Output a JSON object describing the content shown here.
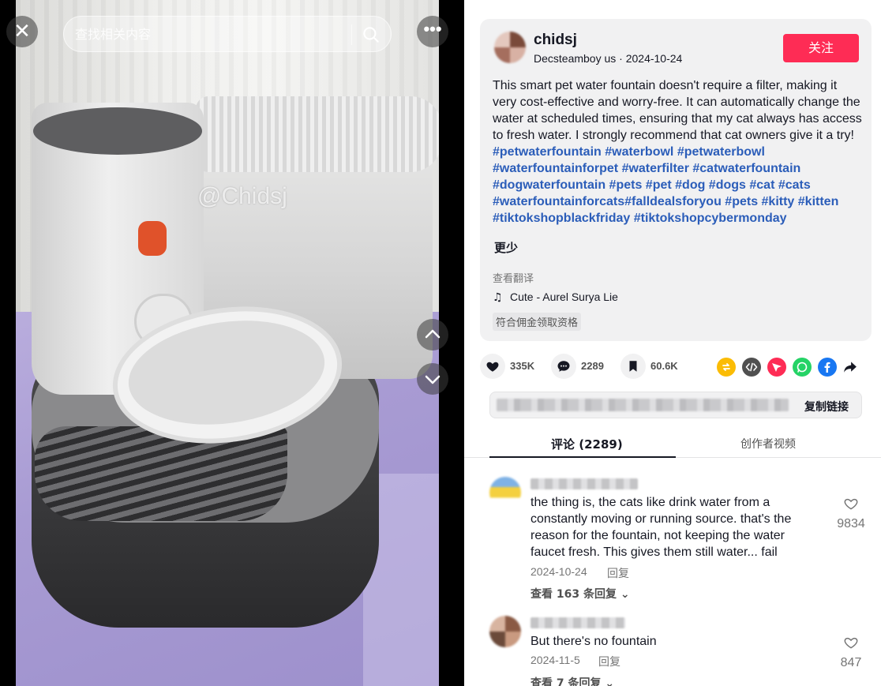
{
  "video": {
    "watermark": "@Chidsj",
    "search_placeholder": "查找相关内容"
  },
  "post": {
    "author": "chidsj",
    "meta": "Decsteamboy us · 2024-10-24",
    "follow_label": "关注",
    "description": "This smart pet water fountain doesn't require a filter, making it very cost-effective and worry-free. It can automatically change the water at scheduled times, ensuring that my cat always has access to fresh water. I strongly recommend that cat owners give it a try! ",
    "hashtags": "#petwaterfountain #waterbowl #petwaterbowl #waterfountainforpet #waterfilter #catwaterfountain #dogwaterfountain #pets #pet #dog #dogs #cat #cats #waterfountainforcats#falldealsforyou #pets #kitty #kitten #tiktokshopblackfriday #tiktokshopcybermonday",
    "less_label": "更少",
    "translate_label": "查看翻译",
    "music": "Cute - Aurel Surya Lie",
    "commission_badge": "符合佣金领取资格"
  },
  "actions": {
    "likes": "335K",
    "comments": "2289",
    "saves": "60.6K",
    "copy_link_label": "复制链接"
  },
  "share_colors": {
    "repost": "#fbbc05",
    "embed": "#505050",
    "send": "#fe2c55",
    "whatsapp": "#25d366",
    "facebook": "#1877f2"
  },
  "tabs": {
    "comments_label": "评论 (2289)",
    "creator_videos_label": "创作者视频"
  },
  "comments": [
    {
      "text": "the thing is, the cats like drink water from a constantly moving or running source. that's the reason for the fountain, not keeping the water faucet fresh. This gives them still water... fail",
      "date": "2024-10-24",
      "reply_label": "回复",
      "more_label": "查看 163 条回复",
      "likes": "9834"
    },
    {
      "text": "But there's no fountain",
      "date": "2024-11-5",
      "reply_label": "回复",
      "more_label": "查看 7 条回复",
      "likes": "847"
    }
  ]
}
